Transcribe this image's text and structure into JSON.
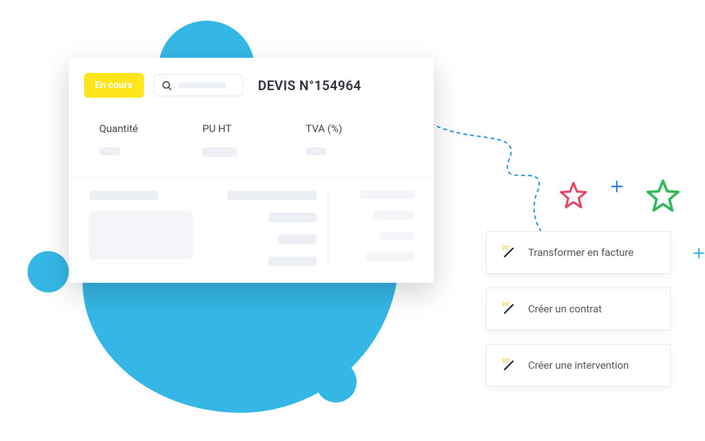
{
  "header": {
    "status_label": "En cours",
    "document_title": "DEVIS N°154964",
    "search_placeholder": ""
  },
  "table": {
    "columns": [
      "Quantité",
      "PU HT",
      "TVA (%)"
    ]
  },
  "actions": [
    {
      "label": "Transformer en facture"
    },
    {
      "label": "Créer un contrat"
    },
    {
      "label": "Créer une intervention"
    }
  ],
  "colors": {
    "accent_blue": "#35b7e6",
    "status_yellow": "#ffe51a",
    "star_red": "#e6405f",
    "star_green": "#2fb85a",
    "wand_yellow": "#f4c21f"
  }
}
